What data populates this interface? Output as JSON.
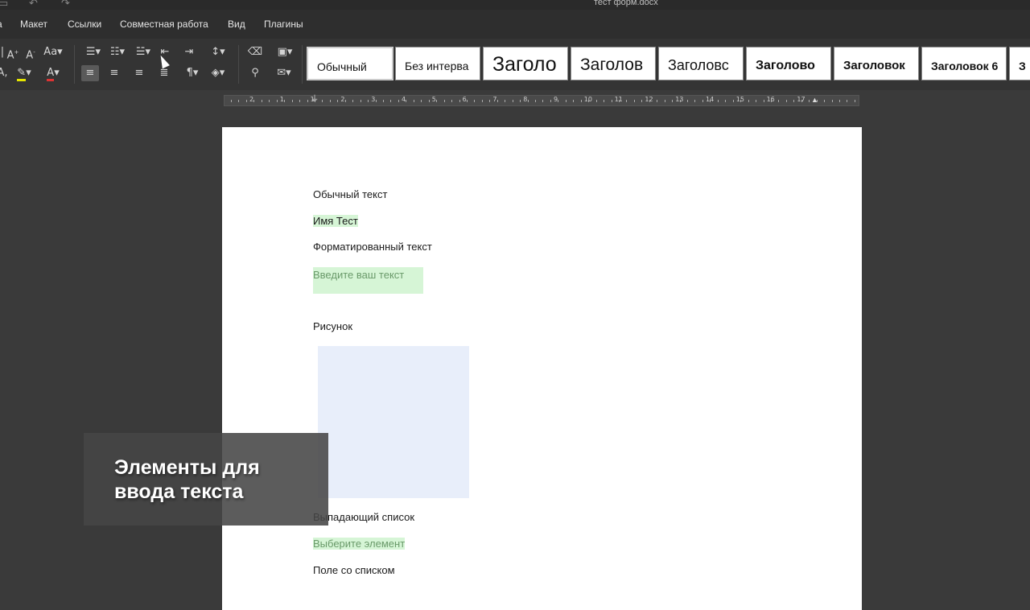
{
  "window": {
    "title": "тест форм.docx"
  },
  "menu": {
    "items": [
      "Макет",
      "Ссылки",
      "Совместная работа",
      "Вид",
      "Плагины"
    ]
  },
  "styles": [
    "Обычный",
    "Без интерва",
    "Заголо",
    "Заголов",
    "Заголовс",
    "Заголово",
    "Заголовок",
    "Заголовок 6",
    "З"
  ],
  "ruler": {
    "labels": [
      "2",
      "1",
      "1",
      "2",
      "3",
      "4",
      "5",
      "6",
      "7",
      "8",
      "9",
      "10",
      "11",
      "12",
      "13",
      "14",
      "15",
      "16",
      "17"
    ]
  },
  "document": {
    "plain_label": "Обычный текст",
    "name_field": "Имя Тест",
    "formatted_label": "Форматированный текст",
    "formatted_placeholder": "Введите ваш текст",
    "picture_label": "Рисунок",
    "dropdown_label": "Выпадающий список",
    "dropdown_placeholder": "Выберите элемент",
    "combobox_label": "Поле со списком"
  },
  "overlay": {
    "line1": "Элементы для",
    "line2": "ввода текста"
  },
  "icons": [
    "undo-icon",
    "redo-icon",
    "increase-font-icon",
    "decrease-font-icon",
    "change-case-icon",
    "bullet-list-icon",
    "numbered-list-icon",
    "multilevel-list-icon",
    "decrease-indent-icon",
    "increase-indent-icon",
    "line-spacing-icon",
    "clear-style-icon",
    "shading-icon",
    "highlight-icon",
    "font-color-icon",
    "align-left-icon",
    "align-center-icon",
    "align-right-icon",
    "justify-icon",
    "paragraph-marks-icon",
    "fill-icon",
    "copy-style-icon",
    "mail-merge-icon"
  ]
}
